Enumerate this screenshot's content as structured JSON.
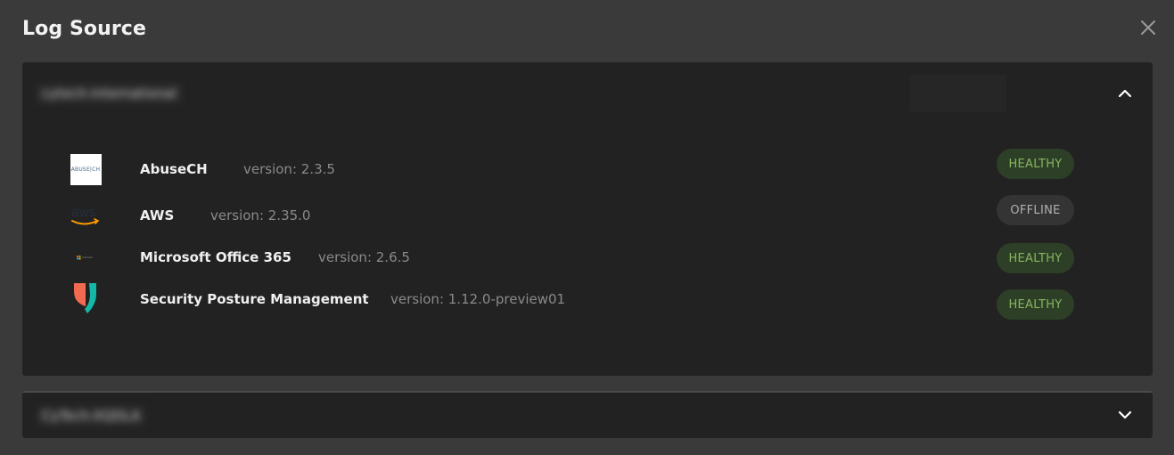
{
  "modal": {
    "title": "Log Source"
  },
  "tenants": [
    {
      "name": "cytech-international",
      "expanded": true,
      "sources": [
        {
          "logo": "abusech-logo",
          "logo_text": "ABUSE|CH",
          "name": "AbuseCH",
          "version": "version: 2.3.5",
          "status": "HEALTHY"
        },
        {
          "logo": "aws-logo",
          "logo_text": "aws",
          "name": "AWS",
          "version": "version: 2.35.0",
          "status": "OFFLINE"
        },
        {
          "logo": "microsoft-logo",
          "logo_text": "",
          "name": "Microsoft Office 365",
          "version": "version: 2.6.5",
          "status": "HEALTHY"
        },
        {
          "logo": "security-posture-logo",
          "logo_text": "",
          "name": "Security Posture Management",
          "version": "version: 1.12.0-preview01",
          "status": "HEALTHY"
        }
      ]
    },
    {
      "name": "CyTech-XQDLA",
      "expanded": false,
      "sources": []
    }
  ],
  "colors": {
    "background": "#3a3a3a",
    "panel": "#222222",
    "healthy_bg": "#2e3f27",
    "healthy_text": "#86b65d",
    "offline_bg": "#343434",
    "offline_text": "#b0b0b0"
  },
  "icons": {
    "close": "close-icon",
    "collapse": "chevron-up-icon",
    "expand": "chevron-down-icon"
  }
}
